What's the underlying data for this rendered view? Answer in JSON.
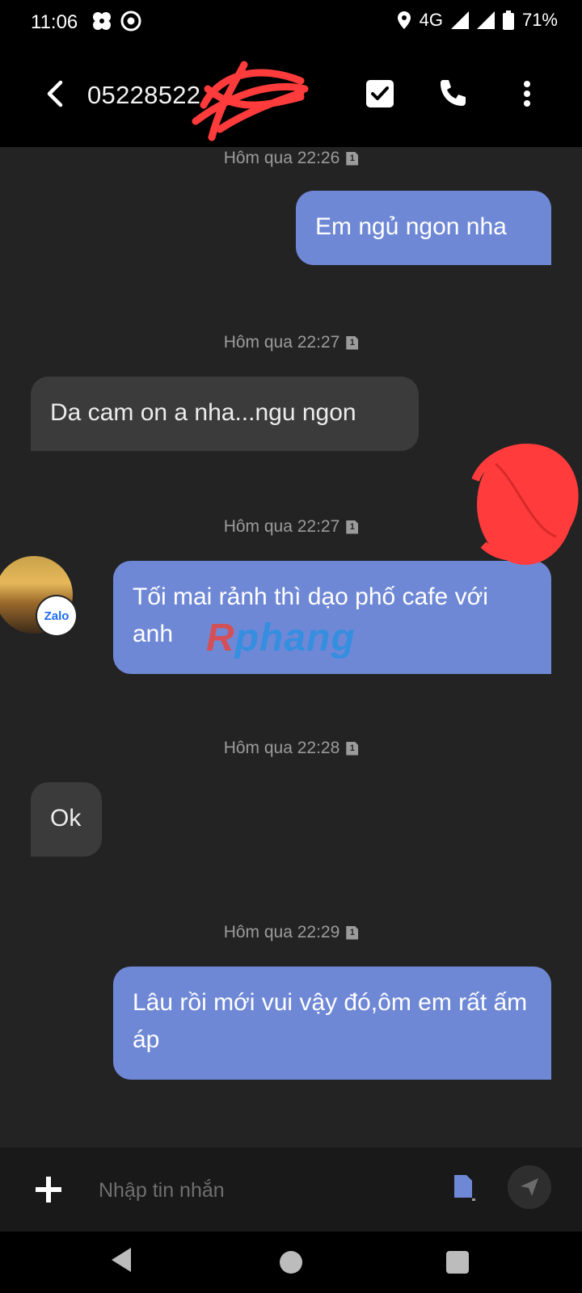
{
  "status_bar": {
    "time": "11:06",
    "network": "4G",
    "battery": "71%"
  },
  "header": {
    "contact": "05228522"
  },
  "messages": [
    {
      "timestamp": "Hôm qua 22:26",
      "text": "Em ngủ ngon nha",
      "direction": "outgoing"
    },
    {
      "timestamp": "Hôm qua 22:27",
      "text": "Da cam on a nha...ngu ngon",
      "direction": "incoming"
    },
    {
      "timestamp": "Hôm qua 22:27",
      "text": "Tối mai rảnh thì dạo phố cafe với anh",
      "direction": "outgoing"
    },
    {
      "timestamp": "Hôm qua 22:28",
      "text": "Ok",
      "direction": "incoming"
    },
    {
      "timestamp": "Hôm qua 22:29",
      "text": "Lâu rồi mới vui vậy đó,ôm em rất ấm áp",
      "direction": "outgoing"
    }
  ],
  "sim_label": "1",
  "avatar_badge": "Zalo",
  "watermark": {
    "first": "R",
    "rest": "phang"
  },
  "composer": {
    "placeholder": "Nhập tin nhắn"
  },
  "colors": {
    "outgoing_bubble": "#6f88d6",
    "incoming_bubble": "#3b3b3b",
    "background": "#232323"
  }
}
